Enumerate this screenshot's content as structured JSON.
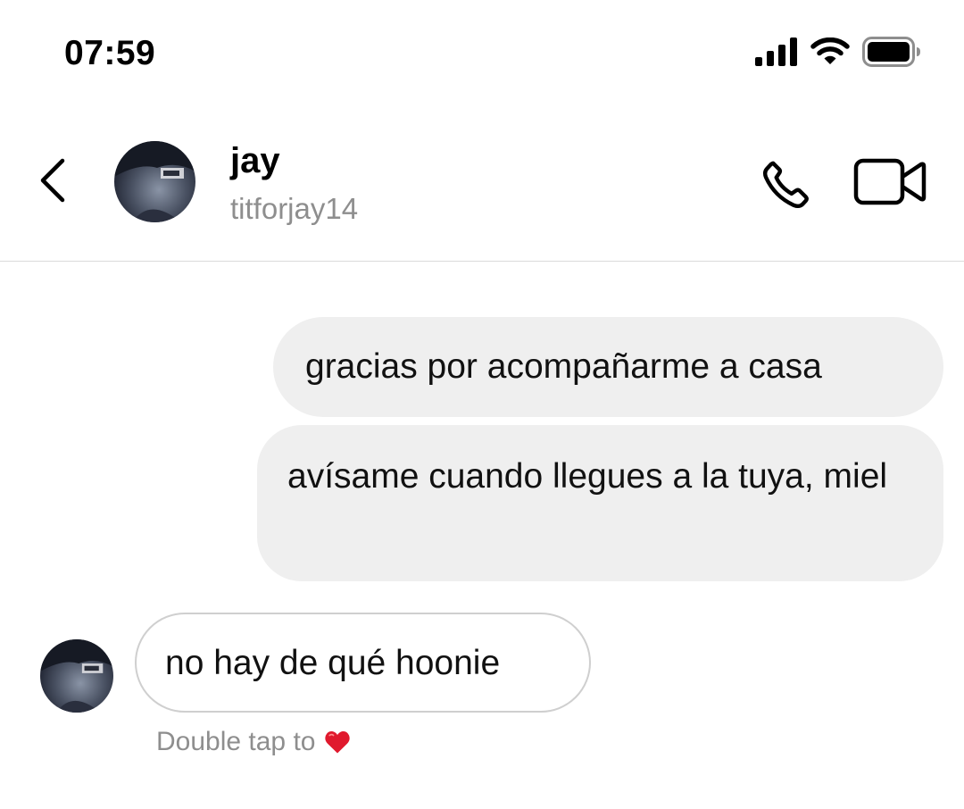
{
  "status_bar": {
    "time": "07:59",
    "icons": [
      "cellular-signal-icon",
      "wifi-icon",
      "battery-icon"
    ]
  },
  "header": {
    "back_icon": "chevron-left-icon",
    "contact_name": "jay",
    "contact_username": "titforjay14",
    "actions": [
      "phone-icon",
      "video-camera-icon"
    ]
  },
  "messages": [
    {
      "direction": "sent",
      "text": "gracias por acompañarme a casa"
    },
    {
      "direction": "sent",
      "text": "avísame cuando llegues a la tuya, miel"
    },
    {
      "direction": "received",
      "text": "no hay de qué hoonie"
    }
  ],
  "reaction_hint": {
    "text": "Double tap to",
    "icon": "heart-icon"
  },
  "colors": {
    "sent_bubble": "#efefef",
    "received_bubble_border": "#cfcfcf",
    "secondary_text": "#8e8e8e",
    "heart": "#e0192d"
  }
}
